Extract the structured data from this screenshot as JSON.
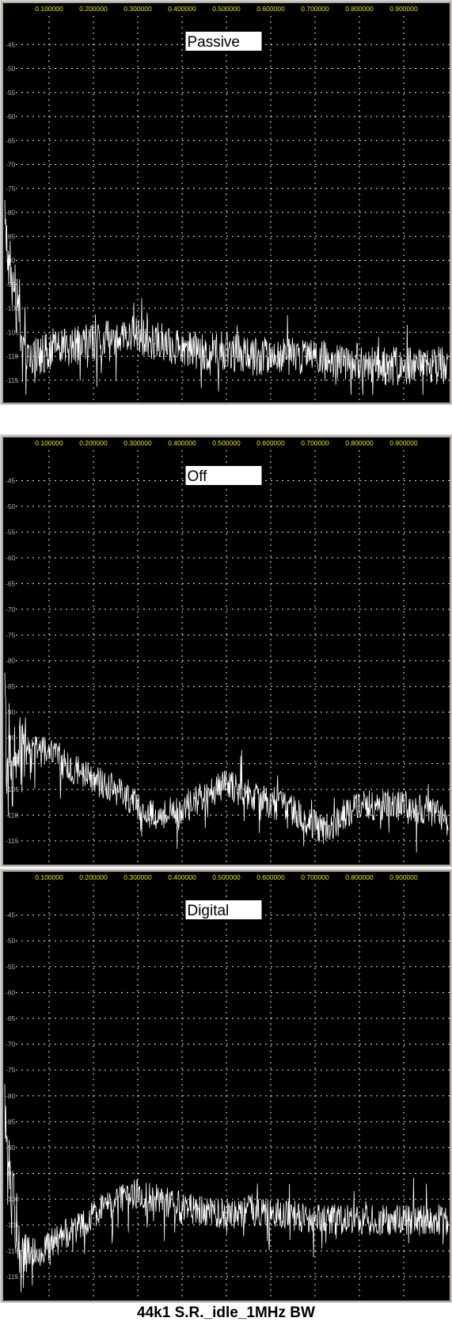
{
  "figure": {
    "caption": "44k1 S.R._idle_1MHz BW",
    "colors": {
      "background": "#000000",
      "grid": "#ffffff",
      "trace": "#ffffff",
      "x_tick_text": "#e6e600",
      "y_tick_text": "#b0b0b0",
      "frame": "#808080"
    }
  },
  "chart_data": [
    {
      "type": "line",
      "label": "Passive",
      "x_ticks": [
        "0.100000",
        "0.200000",
        "0.300000",
        "0.400000",
        "0.500000",
        "0.600000",
        "0.700000",
        "0.800000",
        "0.900000"
      ],
      "y_ticks": [
        "-45",
        "-50",
        "-55",
        "-60",
        "-65",
        "-70",
        "-75",
        "-80",
        "-85",
        "-90",
        "-95",
        "-100",
        "-105",
        "-110",
        "-115"
      ],
      "xlim": [
        0.0,
        1.0
      ],
      "ylim": [
        -119,
        -40
      ],
      "grid": true,
      "series": [
        {
          "x": [
            0.0,
            0.005,
            0.01,
            0.015,
            0.02,
            0.025,
            0.03,
            0.035,
            0.04,
            0.05,
            0.07,
            0.1,
            0.15,
            0.2,
            0.25,
            0.28,
            0.3,
            0.35,
            0.4,
            0.45,
            0.5,
            0.55,
            0.6,
            0.65,
            0.7,
            0.75,
            0.8,
            0.85,
            0.9,
            0.95,
            1.0
          ],
          "values": [
            -77,
            -92,
            -88,
            -96,
            -93,
            -99,
            -97,
            -104,
            -108,
            -110,
            -110,
            -109,
            -108,
            -107,
            -106,
            -105,
            -106,
            -107,
            -108,
            -109,
            -109,
            -110,
            -110,
            -110,
            -110,
            -111,
            -111,
            -112,
            -112,
            -112,
            -112
          ],
          "noise": 4.0
        }
      ]
    },
    {
      "type": "line",
      "label": "Off",
      "x_ticks": [
        "0.100000",
        "0.200000",
        "0.300000",
        "0.400000",
        "0.500000",
        "0.600000",
        "0.700000",
        "0.800000",
        "0.900000"
      ],
      "y_ticks": [
        "-45",
        "-50",
        "-55",
        "-60",
        "-65",
        "-70",
        "-75",
        "-80",
        "-85",
        "-90",
        "-95",
        "-100",
        "-105",
        "-110",
        "-115"
      ],
      "xlim": [
        0.0,
        1.0
      ],
      "ylim": [
        -119,
        -40
      ],
      "grid": true,
      "series": [
        {
          "x": [
            0.0,
            0.005,
            0.01,
            0.015,
            0.02,
            0.03,
            0.04,
            0.05,
            0.1,
            0.15,
            0.2,
            0.25,
            0.3,
            0.33,
            0.35,
            0.4,
            0.45,
            0.5,
            0.55,
            0.6,
            0.65,
            0.7,
            0.72,
            0.75,
            0.8,
            0.85,
            0.9,
            0.95,
            1.0
          ],
          "values": [
            -80,
            -105,
            -93,
            -104,
            -95,
            -97,
            -96,
            -97,
            -98,
            -101,
            -103,
            -105,
            -108,
            -110,
            -110,
            -109,
            -106,
            -104,
            -106,
            -107,
            -109,
            -112,
            -113,
            -111,
            -108,
            -108,
            -108,
            -109,
            -111
          ],
          "noise": 3.0
        }
      ]
    },
    {
      "type": "line",
      "label": "Digital",
      "x_ticks": [
        "0.100000",
        "0.200000",
        "0.300000",
        "0.400000",
        "0.500000",
        "0.600000",
        "0.700000",
        "0.800000",
        "0.900000"
      ],
      "y_ticks": [
        "-45",
        "-50",
        "-55",
        "-60",
        "-65",
        "-70",
        "-75",
        "-80",
        "-85",
        "-90",
        "-95",
        "-100",
        "-105",
        "-110",
        "-115"
      ],
      "xlim": [
        0.0,
        1.0
      ],
      "ylim": [
        -119,
        -40
      ],
      "grid": true,
      "series": [
        {
          "x": [
            0.0,
            0.005,
            0.01,
            0.015,
            0.02,
            0.025,
            0.03,
            0.04,
            0.05,
            0.08,
            0.1,
            0.15,
            0.2,
            0.25,
            0.3,
            0.35,
            0.4,
            0.45,
            0.5,
            0.55,
            0.6,
            0.65,
            0.7,
            0.75,
            0.8,
            0.85,
            0.9,
            0.95,
            1.0
          ],
          "values": [
            -80,
            -95,
            -90,
            -103,
            -97,
            -107,
            -110,
            -111,
            -110,
            -111,
            -109,
            -106,
            -103,
            -100,
            -99,
            -100,
            -102,
            -102,
            -103,
            -102,
            -103,
            -103,
            -104,
            -104,
            -104,
            -104,
            -104,
            -104,
            -104
          ],
          "noise": 3.0
        }
      ]
    }
  ]
}
